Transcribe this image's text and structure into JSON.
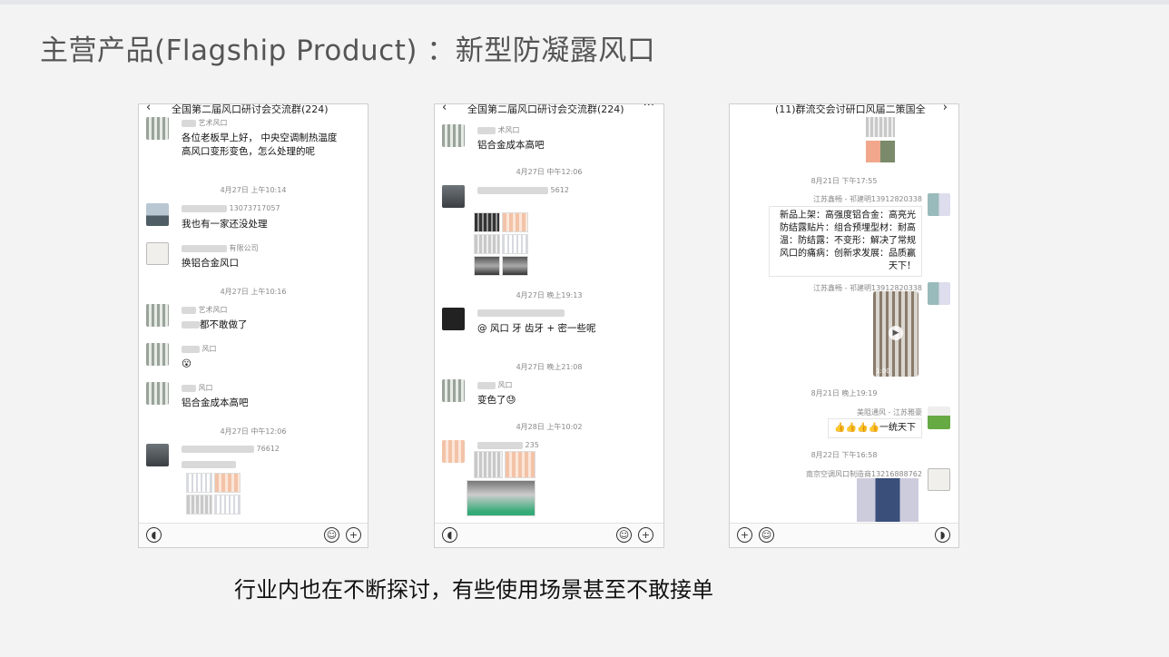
{
  "slide": {
    "title": "主营产品(Flagship Product) ：新型防凝露风口",
    "caption": "行业内也在不断探讨，有些使用场景甚至不敢接单"
  },
  "phone1": {
    "header_title": "全国第二届风口研讨会交流群(224)",
    "msg1_sender": "艺术风口",
    "msg1_text": "各位老板早上好， 中央空调制热温度高风口变形变色，怎么处理的呢",
    "time1": "4月27日 上午10:14",
    "msg2_sender": "13073717057",
    "msg2_text": "我也有一家还没处理",
    "msg3_sender": "有限公司",
    "msg3_text": "换铝合金风口",
    "time2": "4月27日 上午10:16",
    "msg4_sender": "艺术风口",
    "msg4_text": "都不敢做了",
    "msg5_sender": "风口",
    "msg5_text": "😮",
    "msg6_sender": "风口",
    "msg6_text": "铝合金成本高吧",
    "time3": "4月27日 中午12:06",
    "msg7_sender": "76612"
  },
  "phone2": {
    "header_title": "全国第二届风口研讨会交流群(224)",
    "header_more": "···",
    "msg1_sender": "术风口",
    "msg1_text": "铝合金成本高吧",
    "time1": "4月27日 中午12:06",
    "msg2_sender": "5612",
    "time2": "4月27日 晚上19:13",
    "msg3_text": "@  风口 牙 齿牙 + 密一些呢",
    "time3": "4月27日 晚上21:08",
    "msg4_sender": "风口",
    "msg4_text": "变色了😓",
    "time4": "4月28日 上午10:02",
    "msg5_sender": "235"
  },
  "phone3": {
    "header_title": "(11)群流交会讨研口风届二策国全",
    "time1": "8月21日 下午17:55",
    "msg1_sender": "江苏鑫畅 - 祁建明13912820338",
    "msg1_text": "新品上架：高强度铝合金：高亮光防结露贴片：组合预埋型材：耐高温：防结露：不变形：解决了常规风口的痛病：创新求发展：品质赢天下！",
    "msg2_sender": "江苏鑫畅 - 祁建明13912820338",
    "video_duration": "1:00",
    "time2": "8月21日 晚上19:19",
    "msg3_sender": "美阻通风 - 江苏雅豪",
    "msg3_text": "👍👍👍👍一统天下",
    "time3": "8月22日 下午16:58",
    "msg4_sender": "南京空调风口制造商13216888762"
  },
  "icons": [
    "voice-icon",
    "emoji-icon",
    "plus-icon",
    "back-chevron-icon",
    "more-icon",
    "play-icon"
  ]
}
